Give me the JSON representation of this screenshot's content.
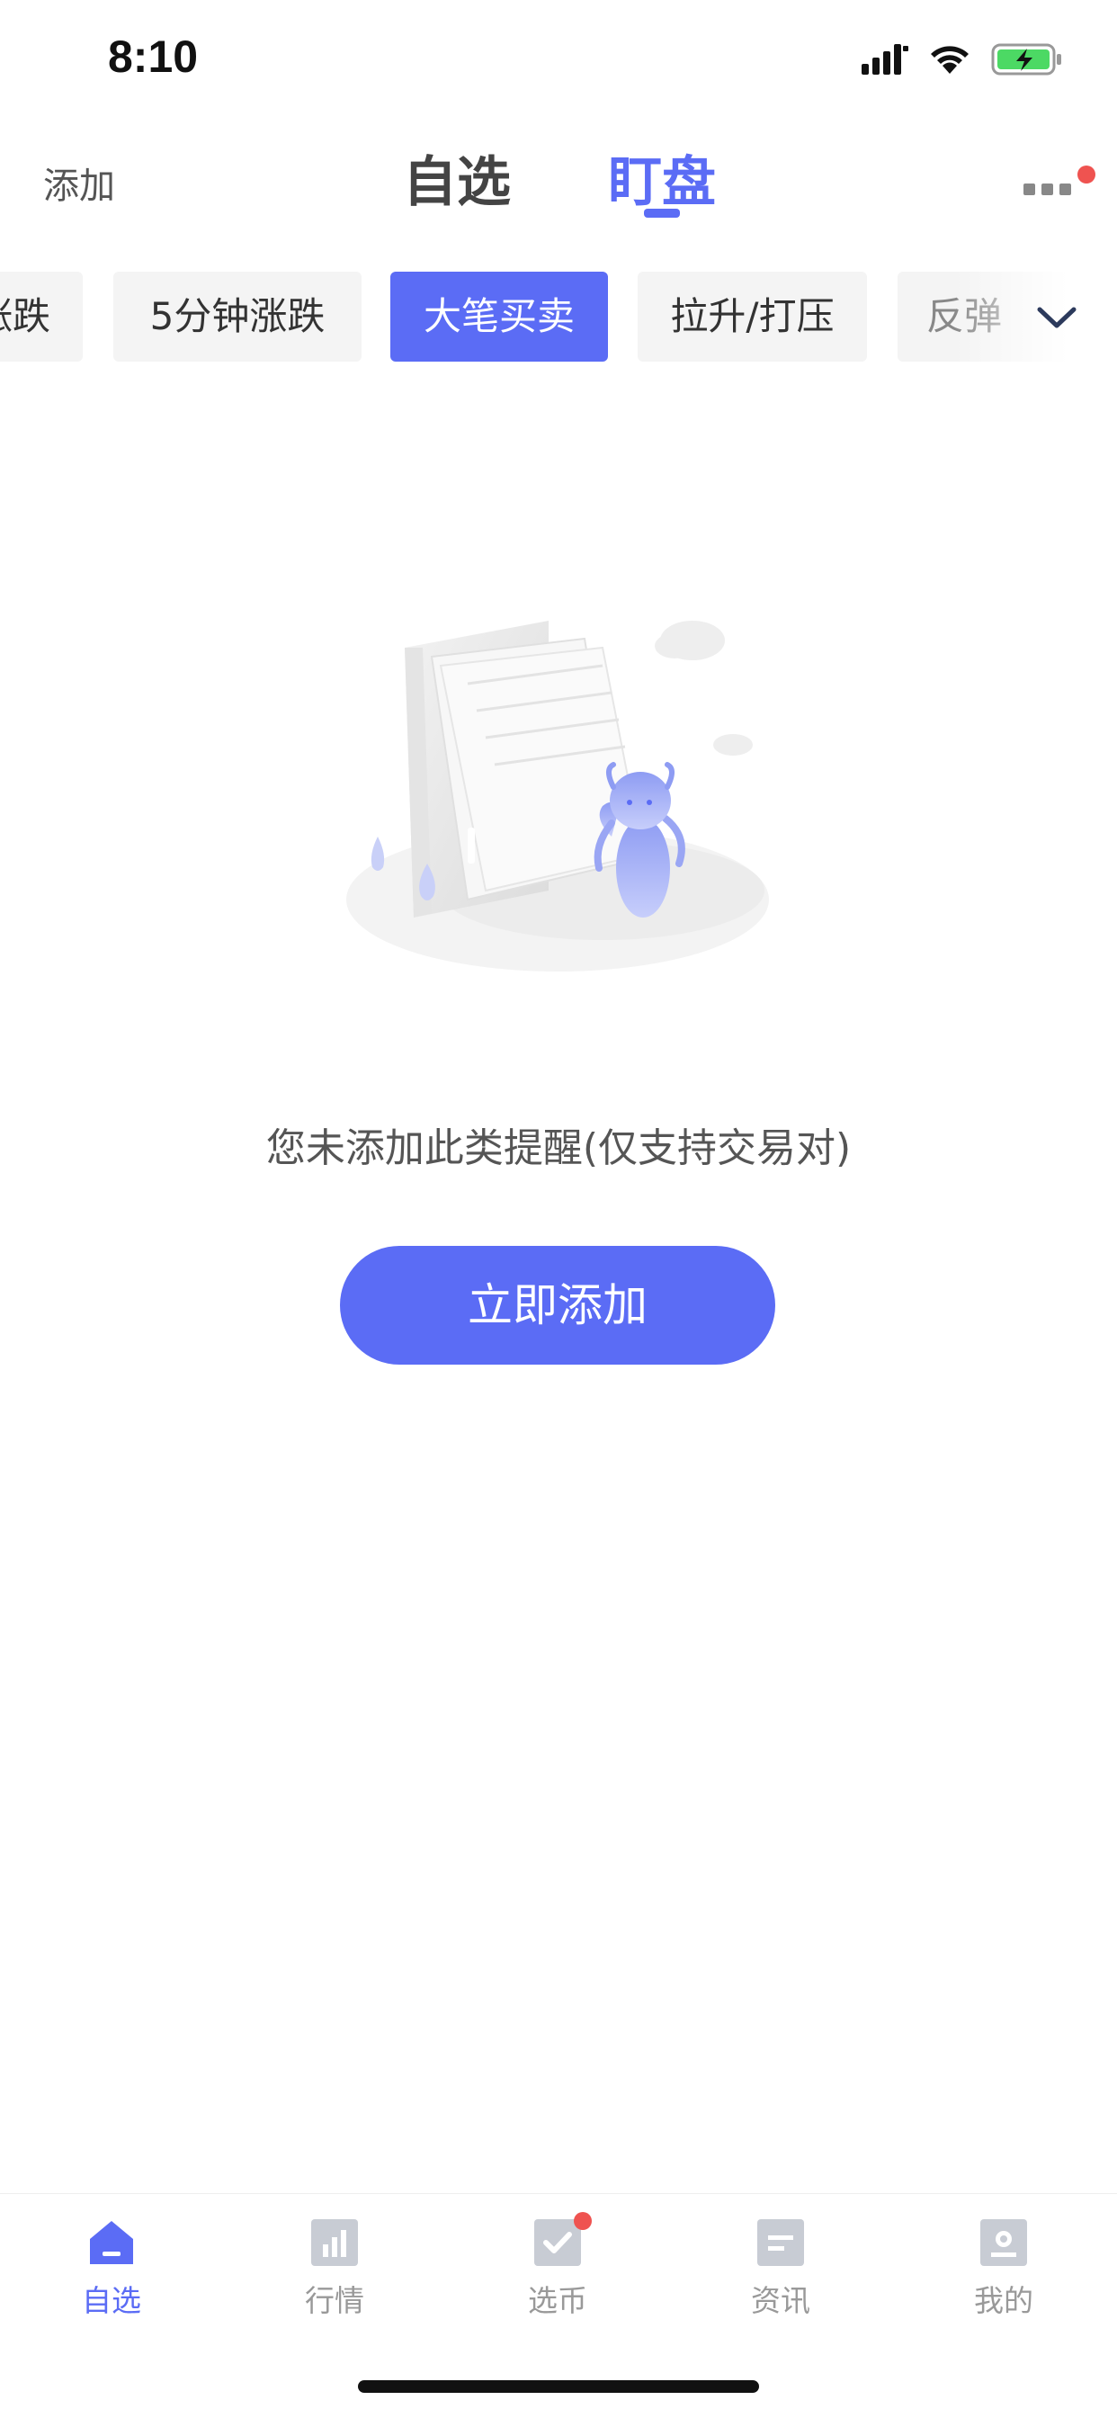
{
  "status_bar": {
    "time": "8:10"
  },
  "header": {
    "add_label": "添加",
    "tabs": [
      {
        "label": "自选",
        "active": false
      },
      {
        "label": "盯盘",
        "active": true
      }
    ]
  },
  "filter_chips": [
    {
      "label": "涨跌",
      "active": false
    },
    {
      "label": "5分钟涨跌",
      "active": false
    },
    {
      "label": "大笔买卖",
      "active": true
    },
    {
      "label": "拉升/打压",
      "active": false
    },
    {
      "label": "反弹",
      "active": false
    }
  ],
  "empty_state": {
    "message": "您未添加此类提醒(仅支持交易对)",
    "button_label": "立即添加"
  },
  "bottom_nav": [
    {
      "label": "自选",
      "icon": "home-icon",
      "active": true
    },
    {
      "label": "行情",
      "icon": "bar-chart-icon",
      "active": false
    },
    {
      "label": "选币",
      "icon": "checkmark-icon",
      "active": false,
      "badge": true
    },
    {
      "label": "资讯",
      "icon": "news-icon",
      "active": false
    },
    {
      "label": "我的",
      "icon": "profile-icon",
      "active": false
    }
  ],
  "colors": {
    "accent": "#5b6cf5",
    "badge": "#ef5350",
    "inactive": "#c8ccd4",
    "battery": "#4cd964"
  }
}
